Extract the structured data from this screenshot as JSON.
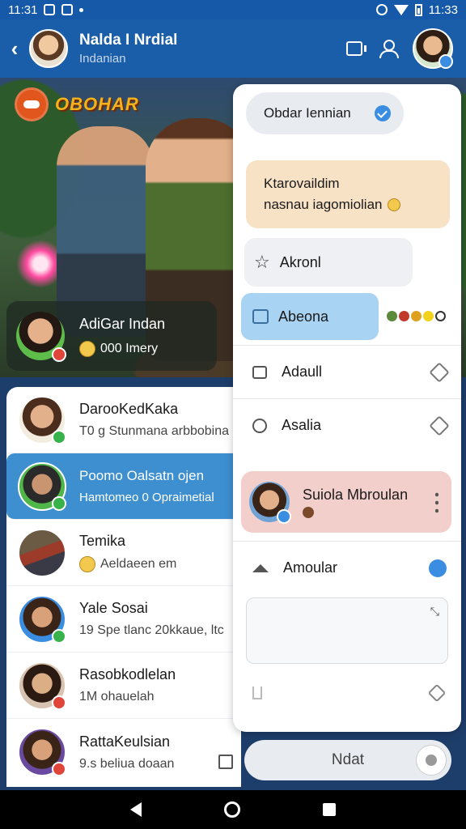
{
  "status_bar": {
    "time_left": "11:31",
    "time_right": "11:33"
  },
  "header": {
    "title": "Nalda I Nrdial",
    "subtitle": "Indanian"
  },
  "hero": {
    "logo_text": "OBOHAR",
    "card": {
      "name": "AdiGar Indan",
      "meta": "000 Imery"
    }
  },
  "chats": [
    {
      "name": "DarooKedKaka",
      "message": "T0 g Stunmana arbbobina",
      "status": "online"
    },
    {
      "name": "Poomo Oalsatn ojen",
      "message": "Hamtomeo 0 Opraimetial",
      "status": "online",
      "active": true
    },
    {
      "name": "Temika",
      "message": "Aeldaeen em",
      "status": "none"
    },
    {
      "name": "Yale Sosai",
      "message": "19 Spe tlanc 20kkaue, ltc",
      "status": "online"
    },
    {
      "name": "Rasobkodlelan",
      "message": "1M ohauelah",
      "status": "busy"
    },
    {
      "name": "RattaKeulsian",
      "message": "9.s beliua doaan",
      "status": "busy"
    }
  ],
  "panel": {
    "chip_label": "Obdar Iennian",
    "note_line1": "Ktarovaildim",
    "note_line2": "nasnau iagomiolian",
    "star_label": "Akronl",
    "blue_label": "Abeona",
    "row1_label": "Adaull",
    "row2_label": "Asalia",
    "contact_name": "Suiola Mbroulan",
    "row3_label": "Amoular"
  },
  "input": {
    "placeholder": "Ndat"
  },
  "colors": {
    "primary": "#1a5ea9",
    "accent": "#3a8de0",
    "note": "#f8e2c6",
    "contact": "#f3cfcc"
  }
}
